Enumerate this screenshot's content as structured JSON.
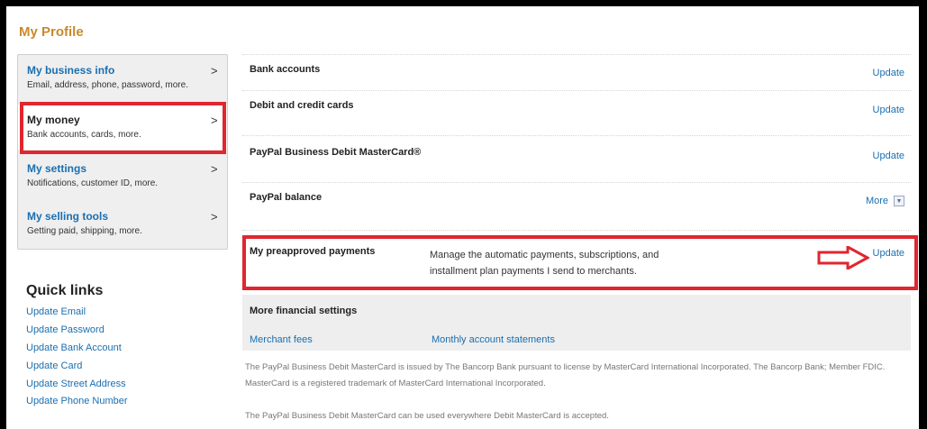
{
  "page_title": "My Profile",
  "sidebar": {
    "items": [
      {
        "title": "My business info",
        "desc": "Email, address, phone, password, more.",
        "chevron": ">"
      },
      {
        "title": "My money",
        "desc": "Bank accounts, cards, more.",
        "chevron": ">"
      },
      {
        "title": "My settings",
        "desc": "Notifications, customer ID, more.",
        "chevron": ">"
      },
      {
        "title": "My selling tools",
        "desc": "Getting paid, shipping, more.",
        "chevron": ">"
      }
    ]
  },
  "quick_links": {
    "title": "Quick links",
    "items": [
      "Update Email",
      "Update Password",
      "Update Bank Account",
      "Update Card",
      "Update Street Address",
      "Update Phone Number"
    ]
  },
  "rows": [
    {
      "label": "Bank accounts",
      "action": "Update"
    },
    {
      "label": "Debit and credit cards",
      "action": "Update"
    },
    {
      "label": "PayPal Business Debit MasterCard®",
      "action": "Update"
    },
    {
      "label": "PayPal balance",
      "action": "More"
    }
  ],
  "preapproved": {
    "label": "My preapproved payments",
    "desc_line1": "Manage the automatic payments, subscriptions, and",
    "desc_line2": "installment plan payments I send to merchants.",
    "action": "Update"
  },
  "financial": {
    "title": "More financial settings",
    "links": [
      "Merchant fees",
      "Monthly account statements"
    ]
  },
  "footnotes": {
    "line1": "The PayPal Business Debit MasterCard is issued by The Bancorp Bank pursuant to license by MasterCard International Incorporated. The Bancorp Bank; Member FDIC.",
    "line2": "MasterCard is a registered trademark of MasterCard International Incorporated.",
    "line3": "The PayPal Business Debit MasterCard can be used everywhere Debit MasterCard is accepted."
  },
  "colors": {
    "highlight": "#e0262e",
    "link": "#1a6fb0",
    "title": "#c88a2c"
  },
  "icons": {
    "dropdown": "chevron-down-icon",
    "arrow": "right-arrow-icon",
    "chevron": "chevron-right-icon"
  }
}
